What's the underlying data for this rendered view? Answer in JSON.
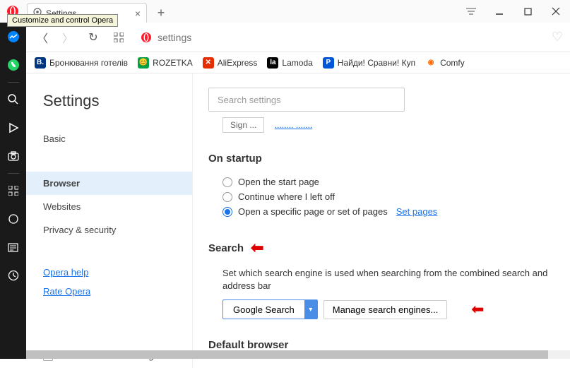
{
  "titlebar": {
    "tab_title": "Settings",
    "tooltip": "Customize and control Opera"
  },
  "addressbar": {
    "url": "settings"
  },
  "bookmarks": [
    {
      "label": "Бронювання готелів",
      "icon_bg": "#00357f",
      "icon_fg": "#fff",
      "icon_text": "B."
    },
    {
      "label": "ROZETKA",
      "icon_bg": "#00a046",
      "icon_fg": "#fff",
      "icon_text": "😊"
    },
    {
      "label": "AliExpress",
      "icon_bg": "#e62e04",
      "icon_fg": "#fff",
      "icon_text": "✕"
    },
    {
      "label": "Lamoda",
      "icon_bg": "#000",
      "icon_fg": "#fff",
      "icon_text": "la"
    },
    {
      "label": "Найди! Сравни! Куп",
      "icon_bg": "#0056d6",
      "icon_fg": "#fff",
      "icon_text": "P"
    },
    {
      "label": "Comfy",
      "icon_bg": "#fff",
      "icon_fg": "#ff6b00",
      "icon_text": "◉"
    }
  ],
  "settings": {
    "title": "Settings",
    "nav": {
      "basic": "Basic",
      "browser": "Browser",
      "websites": "Websites",
      "privacy": "Privacy & security",
      "help": "Opera help",
      "rate": "Rate Opera",
      "advanced": "Show advanced settings"
    },
    "search_placeholder": "Search settings",
    "cutoff": {
      "btn": "Sign ...",
      "link": "........ ......."
    },
    "startup": {
      "title": "On startup",
      "opt1": "Open the start page",
      "opt2": "Continue where I left off",
      "opt3": "Open a specific page or set of pages",
      "set_pages": "Set pages"
    },
    "search": {
      "title": "Search",
      "desc": "Set which search engine is used when searching from the combined search and address bar",
      "selected": "Google Search",
      "manage": "Manage search engines..."
    },
    "default_browser": {
      "title": "Default browser"
    }
  }
}
